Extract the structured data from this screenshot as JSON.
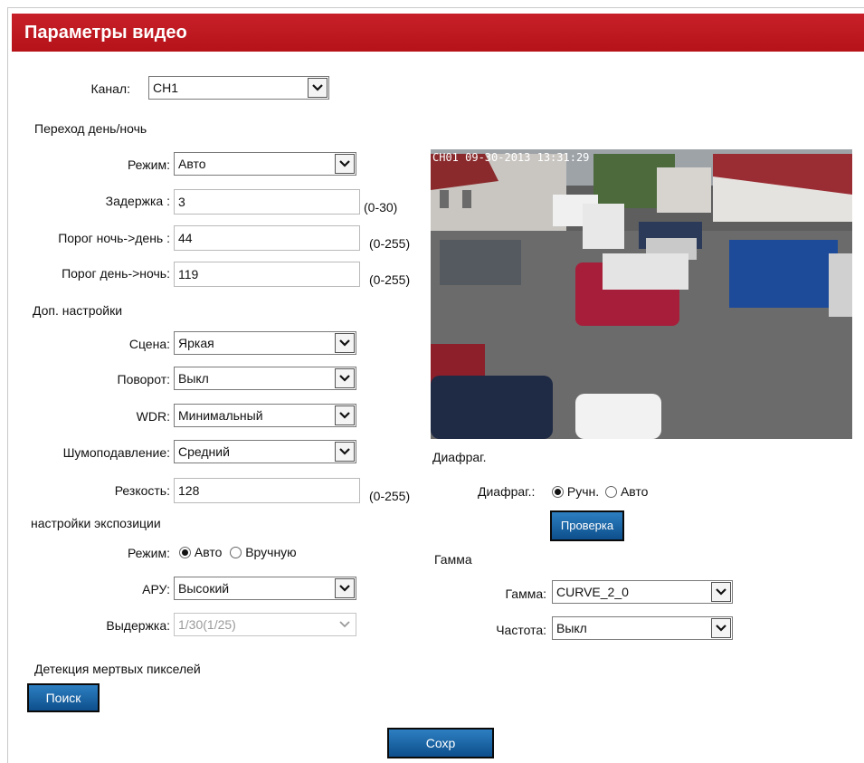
{
  "header": {
    "title": "Параметры видео"
  },
  "channel": {
    "label": "Канал:",
    "value": "CH1"
  },
  "daynight": {
    "section": "Переход день/ночь",
    "mode_label": "Режим:",
    "mode_value": "Авто",
    "delay_label": "Задержка :",
    "delay_value": "3",
    "delay_range": "(0-30)",
    "n2d_label": "Порог ночь->день :",
    "n2d_value": "44",
    "n2d_range": "(0-255)",
    "d2n_label": "Порог день->ночь:",
    "d2n_value": "119",
    "d2n_range": "(0-255)"
  },
  "extra": {
    "section": "Доп. настройки",
    "scene_label": "Сцена:",
    "scene_value": "Яркая",
    "rotate_label": "Поворот:",
    "rotate_value": "Выкл",
    "wdr_label": "WDR:",
    "wdr_value": "Минимальный",
    "nr_label": "Шумоподавление:",
    "nr_value": "Средний",
    "sharp_label": "Резкость:",
    "sharp_value": "128",
    "sharp_range": "(0-255)"
  },
  "exposure": {
    "section": "настройки экспозиции",
    "mode_label": "Режим:",
    "opt_auto": "Авто",
    "opt_manual": "Вручную",
    "agc_label": "АРУ:",
    "agc_value": "Высокий",
    "shutter_label": "Выдержка:",
    "shutter_value": "1/30(1/25)"
  },
  "deadpixel": {
    "section": "Детекция мертвых пикселей",
    "search_button": "Поиск"
  },
  "video": {
    "osd": "CH01  09-30-2013 13:31:29"
  },
  "iris": {
    "section": "Диафраг.",
    "label": "Диафраг.:",
    "opt_manual": "Ручн.",
    "opt_auto": "Авто",
    "check_button": "Проверка"
  },
  "gamma": {
    "section": "Гамма",
    "gamma_label": "Гамма:",
    "gamma_value": "CURVE_2_0",
    "freq_label": "Частота:",
    "freq_value": "Выкл"
  },
  "footer": {
    "save_button": "Сохр"
  }
}
